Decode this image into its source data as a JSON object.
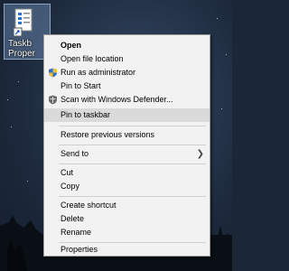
{
  "desktop": {
    "shortcut_label_line1": "Taskb",
    "shortcut_label_line2": "Proper"
  },
  "context_menu": {
    "items": [
      {
        "label": "Open",
        "bold": true
      },
      {
        "label": "Open file location"
      },
      {
        "label": "Run as administrator",
        "icon": "shield-icon"
      },
      {
        "label": "Pin to Start"
      },
      {
        "label": "Scan with Windows Defender...",
        "icon": "defender-icon"
      },
      {
        "label": "Pin to taskbar",
        "highlighted": true
      },
      {
        "label": "Restore previous versions"
      },
      {
        "label": "Send to",
        "submenu": true
      },
      {
        "label": "Cut"
      },
      {
        "label": "Copy"
      },
      {
        "label": "Create shortcut"
      },
      {
        "label": "Delete"
      },
      {
        "label": "Rename"
      },
      {
        "label": "Properties"
      }
    ]
  },
  "colors": {
    "menu_background": "#f2f2f2",
    "highlight": "#dadada",
    "separator": "#cfcfcf"
  }
}
